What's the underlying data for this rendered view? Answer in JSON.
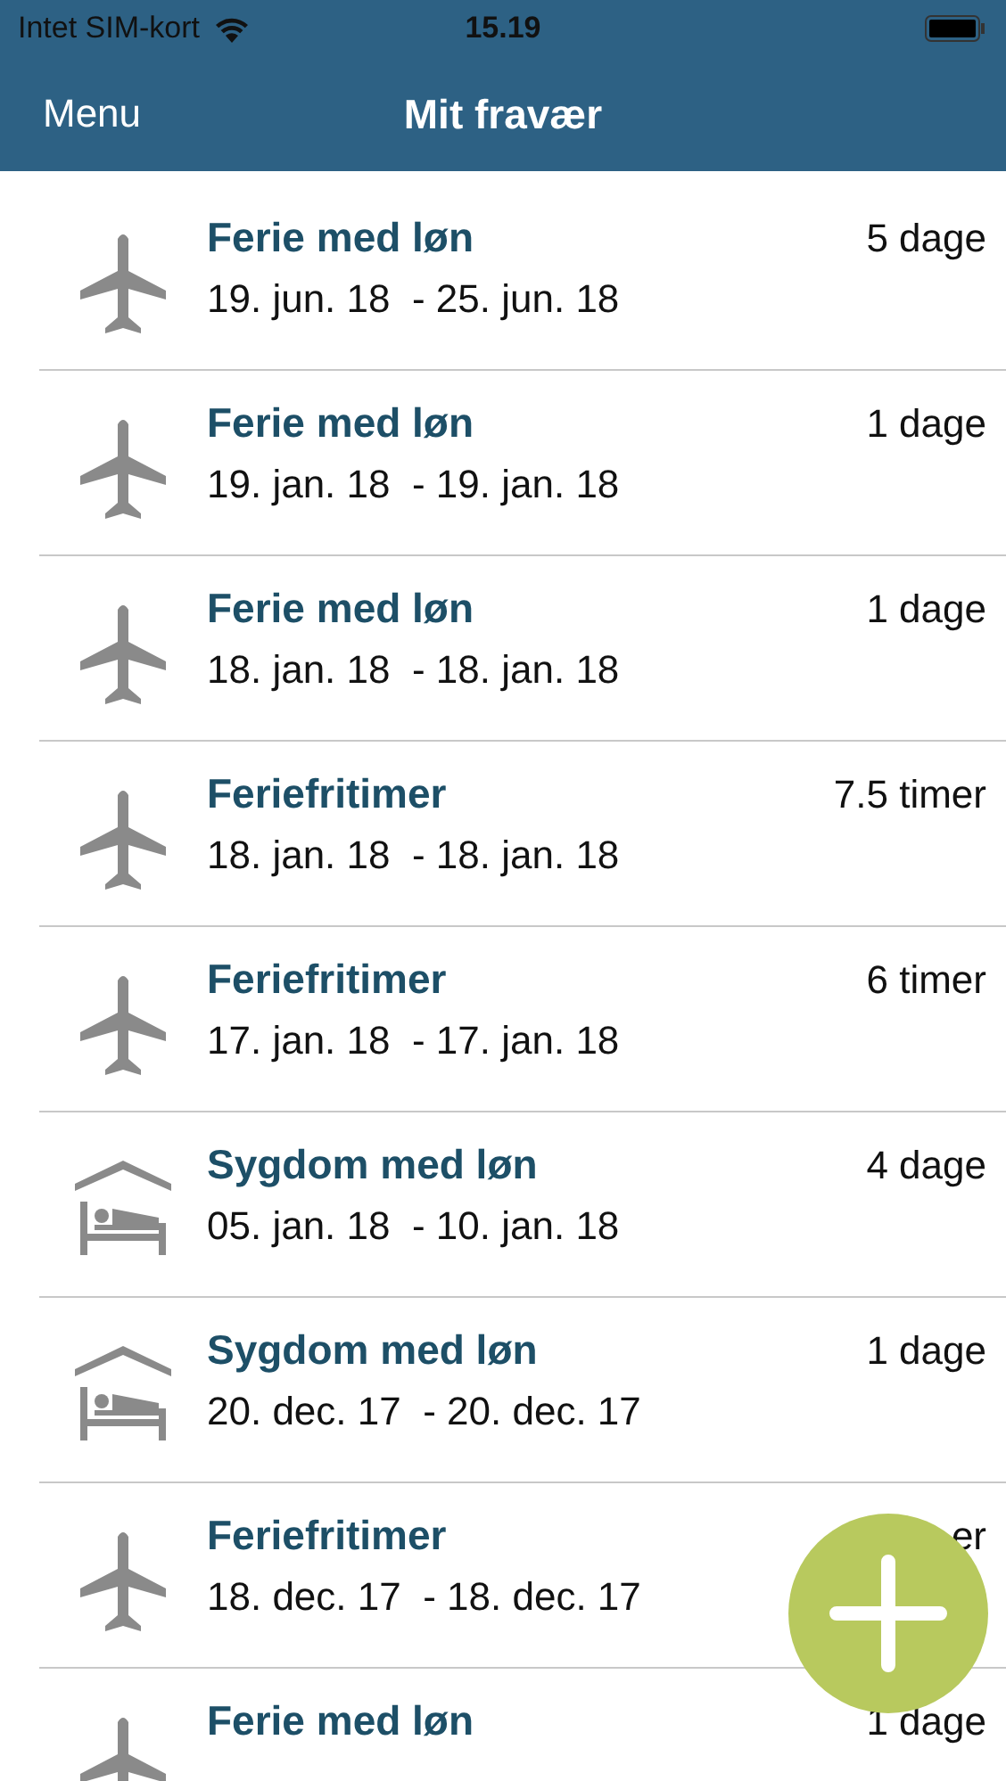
{
  "status_bar": {
    "carrier": "Intet SIM-kort",
    "time": "15.19"
  },
  "nav_bar": {
    "left_button": "Menu",
    "title": "Mit fravær"
  },
  "absences": [
    {
      "kind": "plane",
      "title": "Ferie med løn",
      "dates": "19. jun. 18  - 25. jun. 18",
      "amount": "5 dage"
    },
    {
      "kind": "plane",
      "title": "Ferie med løn",
      "dates": "19. jan. 18  - 19. jan. 18",
      "amount": "1 dage"
    },
    {
      "kind": "plane",
      "title": "Ferie med løn",
      "dates": "18. jan. 18  - 18. jan. 18",
      "amount": "1 dage"
    },
    {
      "kind": "plane",
      "title": "Feriefritimer",
      "dates": "18. jan. 18  - 18. jan. 18",
      "amount": "7.5 timer"
    },
    {
      "kind": "plane",
      "title": "Feriefritimer",
      "dates": "17. jan. 18  - 17. jan. 18",
      "amount": "6 timer"
    },
    {
      "kind": "bed",
      "title": "Sygdom med løn",
      "dates": "05. jan. 18  - 10. jan. 18",
      "amount": "4 dage"
    },
    {
      "kind": "bed",
      "title": "Sygdom med løn",
      "dates": "20. dec. 17  - 20. dec. 17",
      "amount": "1 dage"
    },
    {
      "kind": "plane",
      "title": "Feriefritimer",
      "dates": "18. dec. 17  - 18. dec. 17",
      "amount": "er"
    },
    {
      "kind": "plane",
      "title": "Ferie med løn",
      "amount": "1 dage"
    }
  ]
}
